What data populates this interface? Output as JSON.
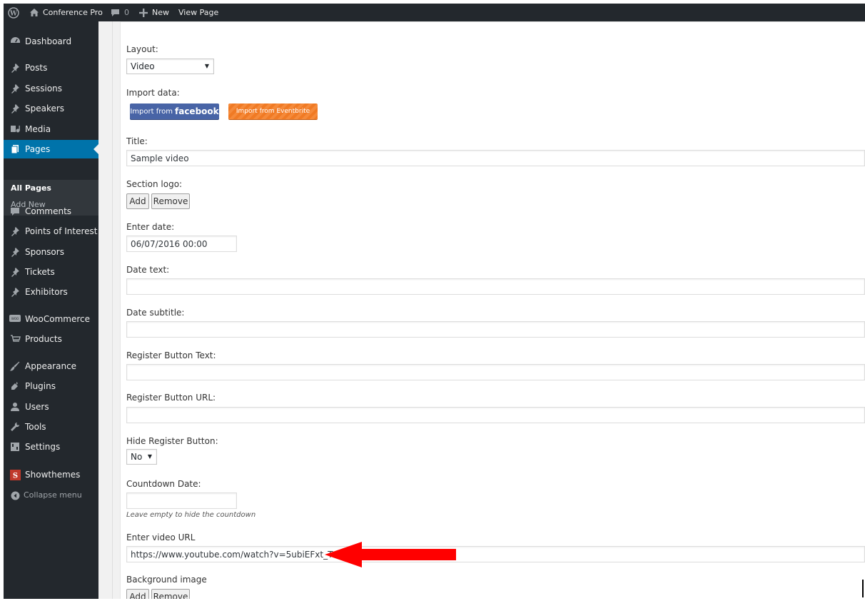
{
  "adminbar": {
    "site_name": "Conference Pro",
    "comments_count": "0",
    "new_label": "New",
    "view_page_label": "View Page"
  },
  "sidebar": {
    "items": [
      {
        "label": "Dashboard",
        "icon": "dashboard-icon"
      },
      {
        "label": "Posts",
        "icon": "pin-icon"
      },
      {
        "label": "Sessions",
        "icon": "pin-icon"
      },
      {
        "label": "Speakers",
        "icon": "pin-icon"
      },
      {
        "label": "Media",
        "icon": "media-icon"
      },
      {
        "label": "Pages",
        "icon": "pages-icon"
      },
      {
        "label": "Comments",
        "icon": "comment-icon"
      },
      {
        "label": "Points of Interest",
        "icon": "pin-icon"
      },
      {
        "label": "Sponsors",
        "icon": "pin-icon"
      },
      {
        "label": "Tickets",
        "icon": "pin-icon"
      },
      {
        "label": "Exhibitors",
        "icon": "pin-icon"
      },
      {
        "label": "WooCommerce",
        "icon": "woocommerce-icon"
      },
      {
        "label": "Products",
        "icon": "cart-icon"
      },
      {
        "label": "Appearance",
        "icon": "brush-icon"
      },
      {
        "label": "Plugins",
        "icon": "plugin-icon"
      },
      {
        "label": "Users",
        "icon": "user-icon"
      },
      {
        "label": "Tools",
        "icon": "wrench-icon"
      },
      {
        "label": "Settings",
        "icon": "settings-icon"
      },
      {
        "label": "Showthemes",
        "icon": "showthemes-icon"
      },
      {
        "label": "Collapse menu",
        "icon": "collapse-icon"
      }
    ],
    "submenu": [
      "All Pages",
      "Add New"
    ]
  },
  "form": {
    "layout_label": "Layout:",
    "layout_value": "Video",
    "import_label": "Import data:",
    "facebook_prefix": "Import from",
    "facebook_brand": "facebook",
    "eventbrite_label": "Import from Eventbrite",
    "title_label": "Title:",
    "title_value": "Sample video",
    "section_logo_label": "Section logo:",
    "add_label": "Add",
    "remove_label": "Remove",
    "enter_date_label": "Enter date:",
    "enter_date_value": "06/07/2016 00:00",
    "date_text_label": "Date text:",
    "date_subtitle_label": "Date subtitle:",
    "register_text_label": "Register Button Text:",
    "register_url_label": "Register Button URL:",
    "hide_register_label": "Hide Register Button:",
    "hide_register_value": "No",
    "countdown_label": "Countdown Date:",
    "countdown_desc": "Leave empty to hide the countdown",
    "video_url_label": "Enter video URL",
    "video_url_value": "https://www.youtube.com/watch?v=5ubiEFxt_TQ",
    "background_label": "Background image"
  },
  "colors": {
    "adminbar_bg": "#23282d",
    "sidebar_bg": "#23282d",
    "current_menu": "#0073aa",
    "annotation_arrow": "#ff0000",
    "facebook_blue": "#4864a6",
    "eventbrite_orange": "#f58a3a"
  }
}
